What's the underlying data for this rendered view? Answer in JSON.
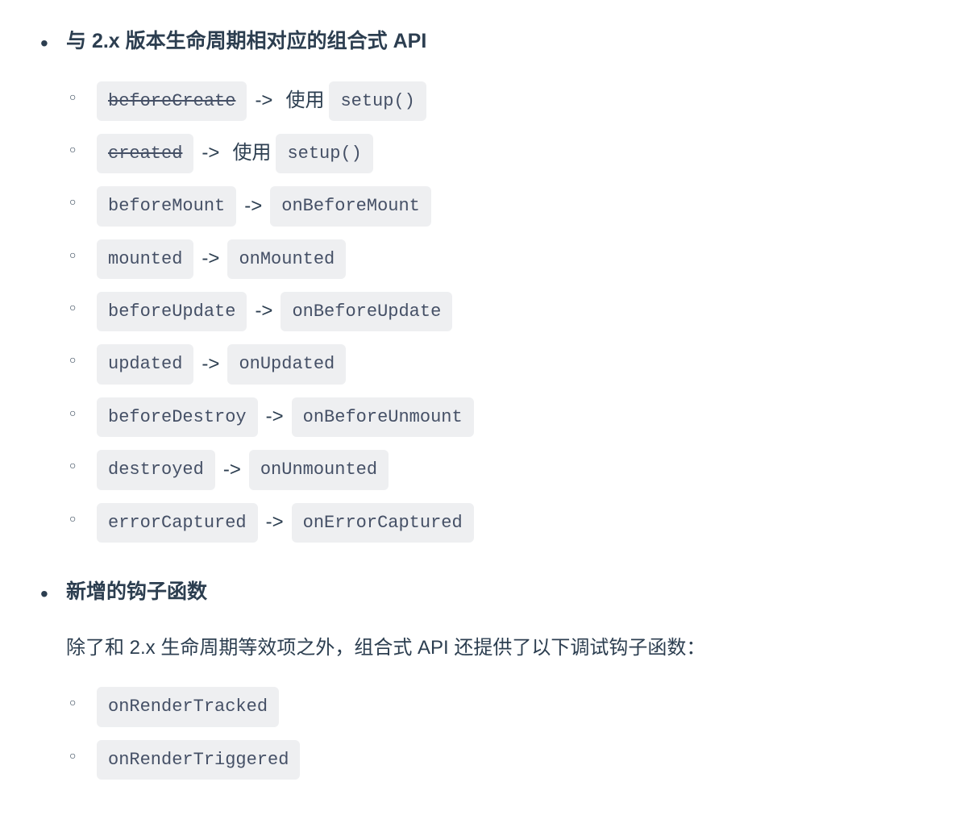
{
  "section1": {
    "heading": "与 2.x 版本生命周期相对应的组合式 API",
    "items": [
      {
        "old": "beforeCreate",
        "strike": true,
        "arrow": "->",
        "middle": "使用",
        "new": "setup()"
      },
      {
        "old": "created",
        "strike": true,
        "arrow": "->",
        "middle": "使用",
        "new": "setup()"
      },
      {
        "old": "beforeMount",
        "strike": false,
        "arrow": "->",
        "middle": "",
        "new": "onBeforeMount"
      },
      {
        "old": "mounted",
        "strike": false,
        "arrow": "->",
        "middle": "",
        "new": "onMounted"
      },
      {
        "old": "beforeUpdate",
        "strike": false,
        "arrow": "->",
        "middle": "",
        "new": "onBeforeUpdate"
      },
      {
        "old": "updated",
        "strike": false,
        "arrow": "->",
        "middle": "",
        "new": "onUpdated"
      },
      {
        "old": "beforeDestroy",
        "strike": false,
        "arrow": "->",
        "middle": "",
        "new": "onBeforeUnmount"
      },
      {
        "old": "destroyed",
        "strike": false,
        "arrow": "->",
        "middle": "",
        "new": "onUnmounted"
      },
      {
        "old": "errorCaptured",
        "strike": false,
        "arrow": "->",
        "middle": "",
        "new": "onErrorCaptured"
      }
    ]
  },
  "section2": {
    "heading": "新增的钩子函数",
    "description": "除了和 2.x 生命周期等效项之外，组合式 API 还提供了以下调试钩子函数：",
    "items": [
      {
        "code": "onRenderTracked"
      },
      {
        "code": "onRenderTriggered"
      }
    ]
  }
}
